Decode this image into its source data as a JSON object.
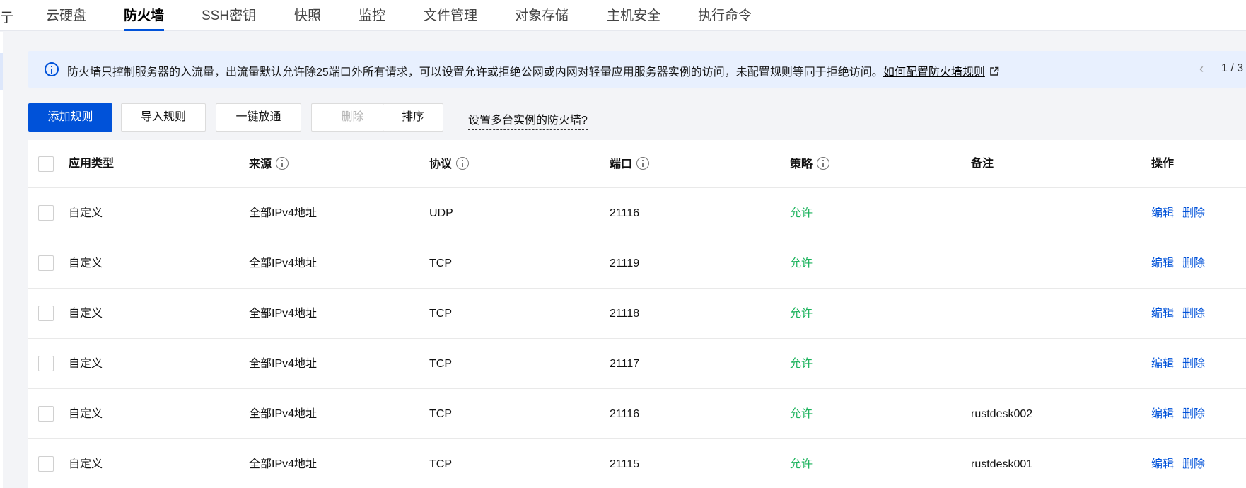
{
  "tabs": {
    "cut_label": "亍",
    "items": [
      "云硬盘",
      "防火墙",
      "SSH密钥",
      "快照",
      "监控",
      "文件管理",
      "对象存储",
      "主机安全",
      "执行命令"
    ],
    "active_index": 1
  },
  "alert": {
    "message": "防火墙只控制服务器的入流量，出流量默认允许除25端口外所有请求，可以设置允许或拒绝公网或内网对轻量应用服务器实例的访问，未配置规则等同于拒绝访问。",
    "link": "如何配置防火墙规则",
    "pager_prev": "‹",
    "pager": "1 / 3"
  },
  "toolbar": {
    "add_rule": "添加规则",
    "import_rule": "导入规则",
    "one_click_open": "一键放通",
    "delete": "删除",
    "sort": "排序",
    "multi_instance_link": "设置多台实例的防火墙?"
  },
  "table": {
    "headers": {
      "app_type": "应用类型",
      "source": "来源",
      "protocol": "协议",
      "port": "端口",
      "policy": "策略",
      "remark": "备注",
      "actions": "操作"
    },
    "rows": [
      {
        "app_type": "自定义",
        "source": "全部IPv4地址",
        "protocol": "UDP",
        "port": "21116",
        "policy": "允许",
        "remark": "",
        "edit": "编辑",
        "delete": "删除"
      },
      {
        "app_type": "自定义",
        "source": "全部IPv4地址",
        "protocol": "TCP",
        "port": "21119",
        "policy": "允许",
        "remark": "",
        "edit": "编辑",
        "delete": "删除"
      },
      {
        "app_type": "自定义",
        "source": "全部IPv4地址",
        "protocol": "TCP",
        "port": "21118",
        "policy": "允许",
        "remark": "",
        "edit": "编辑",
        "delete": "删除"
      },
      {
        "app_type": "自定义",
        "source": "全部IPv4地址",
        "protocol": "TCP",
        "port": "21117",
        "policy": "允许",
        "remark": "",
        "edit": "编辑",
        "delete": "删除"
      },
      {
        "app_type": "自定义",
        "source": "全部IPv4地址",
        "protocol": "TCP",
        "port": "21116",
        "policy": "允许",
        "remark": "rustdesk002",
        "edit": "编辑",
        "delete": "删除"
      },
      {
        "app_type": "自定义",
        "source": "全部IPv4地址",
        "protocol": "TCP",
        "port": "21115",
        "policy": "允许",
        "remark": "rustdesk001",
        "edit": "编辑",
        "delete": "删除"
      }
    ]
  },
  "colors": {
    "primary": "#0052d9",
    "allow": "#1bb35c",
    "alert_bg": "#e8f0fe"
  },
  "icons": [
    "info-icon",
    "external-link-icon",
    "chevron-left-icon",
    "question-info-icon",
    "checkbox"
  ]
}
